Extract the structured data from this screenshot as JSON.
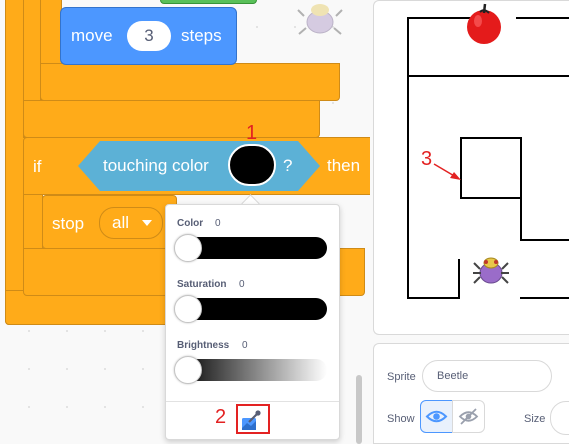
{
  "blocks": {
    "move_label": "move",
    "move_steps": "3",
    "steps_label": "steps",
    "if_label": "if",
    "touching_label": "touching color",
    "touching_end": "?",
    "then_label": "then",
    "stop_label": "stop",
    "stop_option": "all"
  },
  "color_picker": {
    "color_label": "Color",
    "color_value": "0",
    "saturation_label": "Saturation",
    "saturation_value": "0",
    "brightness_label": "Brightness",
    "brightness_value": "0",
    "selected_color": "#000000",
    "color_level": 0,
    "saturation_level": 0,
    "brightness_level": 0
  },
  "sprite_info": {
    "sprite_label": "Sprite",
    "sprite_name": "Beetle",
    "show_label": "Show",
    "size_label": "Size"
  },
  "annotations": {
    "a1": "1",
    "a2": "2",
    "a3": "3"
  },
  "colors": {
    "control": "#ffab19",
    "motion": "#4c97ff",
    "sensing": "#5cb1d6",
    "accent": "#4c97ff",
    "annotation": "#e32222"
  },
  "icons": [
    "beetle-sprite-icon",
    "apple-sprite-icon",
    "dropdown-arrow-icon",
    "eyedropper-icon",
    "eye-icon",
    "eye-slash-icon"
  ]
}
